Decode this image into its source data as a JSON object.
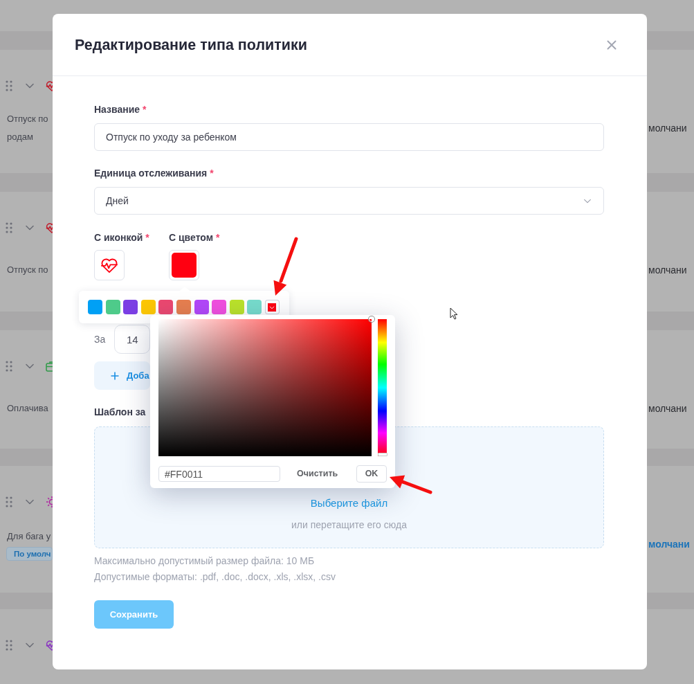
{
  "background_rows": [
    {
      "color": "#c01c2b",
      "text_lines": [
        "Отпуск по",
        "родам"
      ],
      "status": {
        "text": "молчани",
        "highlighted": false
      }
    },
    {
      "color": "#c01c2b",
      "text_lines": [
        "Отпуск по"
      ],
      "status": {
        "text": "молчани",
        "highlighted": false
      }
    },
    {
      "color": "#2f9a48",
      "text_lines": [
        "Оплачива"
      ],
      "status": {
        "text": "молчани",
        "highlighted": false
      }
    },
    {
      "color": "#b01aa0",
      "text_lines": [
        "Для бага у"
      ],
      "badge": "По умолч",
      "status": {
        "text": "молчани",
        "highlighted": true
      }
    },
    {
      "color": "#8a34c2"
    }
  ],
  "modal": {
    "title": "Редактирование типа политики",
    "fields": [
      {
        "kind": "text",
        "label": "Название",
        "required_mark": "*",
        "value": "Отпуск по уходу за ребенком"
      },
      {
        "kind": "select",
        "label": "Единица отслеживания",
        "required_mark": "*",
        "value": "Дней"
      }
    ],
    "appearance": [
      {
        "kind": "icon",
        "label": "С иконкой",
        "required_mark": "*"
      },
      {
        "kind": "color",
        "label": "С цветом",
        "required_mark": "*"
      }
    ],
    "palette": [
      {
        "kind": "preset",
        "color": "#00a0f5",
        "selected": false
      },
      {
        "kind": "preset",
        "color": "#4ecb8a",
        "selected": false
      },
      {
        "kind": "preset",
        "color": "#7b3fe4",
        "selected": false
      },
      {
        "kind": "preset",
        "color": "#fdc704",
        "selected": false
      },
      {
        "kind": "preset",
        "color": "#ec4870",
        "selected": false
      },
      {
        "kind": "preset",
        "color": "#e87f4f",
        "selected": false
      },
      {
        "kind": "preset",
        "color": "#b347fa",
        "selected": false
      },
      {
        "kind": "preset",
        "color": "#f24fe0",
        "selected": false
      },
      {
        "kind": "preset",
        "color": "#bbe32a",
        "selected": false
      },
      {
        "kind": "preset",
        "color": "#77dccc",
        "selected": false
      },
      {
        "kind": "custom",
        "color": "#ff0011",
        "selected": true
      }
    ],
    "period": {
      "label": "За",
      "value": "14"
    },
    "add_button": {
      "label": "Доба"
    },
    "template": {
      "label": "Шаблон за",
      "link": "Выберите файл",
      "hint": "или перетащите его сюда"
    },
    "notes": [
      "Максимально допустимый размер файла: 10 МБ",
      "Допустимые форматы: .pdf, .doc, .docx, .xls, .xlsx, .csv"
    ],
    "save_button": {
      "label": "Сохранить",
      "disabled": true
    }
  },
  "color_picker": {
    "saturation": {
      "level": 1
    },
    "brightness": {
      "level": 1
    },
    "hue": {
      "level": 0
    },
    "hex": "#FF0011",
    "clear_button": "Очистить",
    "ok_button": "OK"
  }
}
